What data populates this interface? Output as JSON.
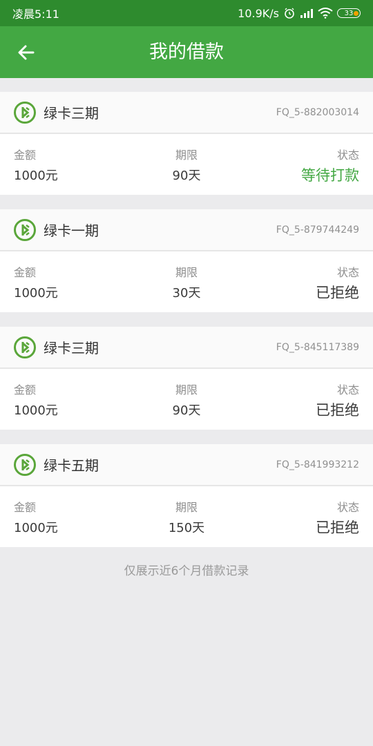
{
  "statusbar": {
    "time": "凌晨5:11",
    "speed": "10.9K/s",
    "battery": "33"
  },
  "header": {
    "title": "我的借款"
  },
  "labels": {
    "amount": "金额",
    "term": "期限",
    "status": "状态"
  },
  "loans": [
    {
      "product": "绿卡三期",
      "order_no": "FQ_5-882003014",
      "amount": "1000元",
      "term": "90天",
      "status": "等待打款",
      "state": "pending"
    },
    {
      "product": "绿卡一期",
      "order_no": "FQ_5-879744249",
      "amount": "1000元",
      "term": "30天",
      "status": "已拒绝",
      "state": "rejected"
    },
    {
      "product": "绿卡三期",
      "order_no": "FQ_5-845117389",
      "amount": "1000元",
      "term": "90天",
      "status": "已拒绝",
      "state": "rejected"
    },
    {
      "product": "绿卡五期",
      "order_no": "FQ_5-841993212",
      "amount": "1000元",
      "term": "150天",
      "status": "已拒绝",
      "state": "rejected"
    }
  ],
  "footer": {
    "note": "仅展示近6个月借款记录"
  },
  "colors": {
    "brand": "#43a843",
    "statusbar": "#2e8b2e",
    "pending": "#43a843"
  },
  "icons": {
    "back": "arrow-left-icon",
    "product_logo": "green-card-logo-icon"
  }
}
